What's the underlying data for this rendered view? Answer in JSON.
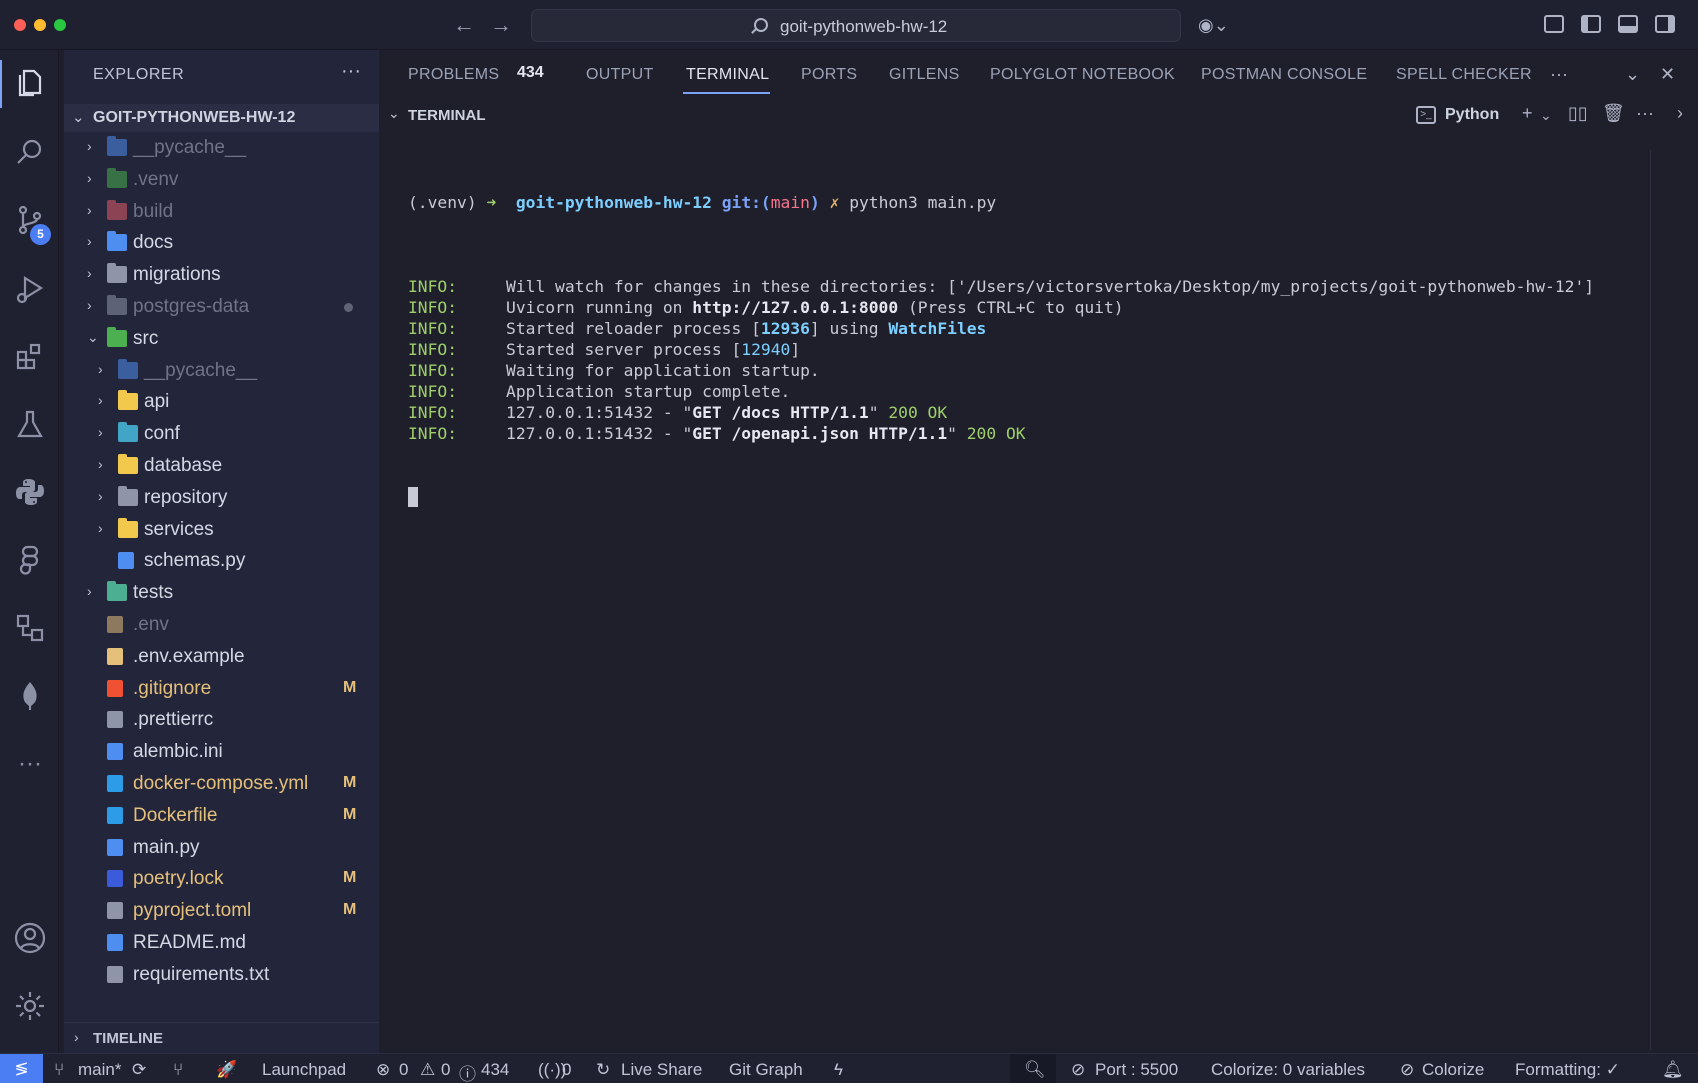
{
  "window": {
    "title": "goit-pythonweb-hw-12"
  },
  "activity": {
    "scm_badge": "5"
  },
  "sidebar": {
    "title": "EXPLORER",
    "more": "···",
    "root": "GOIT-PYTHONWEB-HW-12",
    "items": [
      {
        "label": "__pycache__",
        "kind": "folder",
        "indent": 0,
        "chevron": "›",
        "dim": true,
        "color": "#4d8ef0"
      },
      {
        "label": ".venv",
        "kind": "folder",
        "indent": 0,
        "chevron": "›",
        "dim": true,
        "color": "#4caf50"
      },
      {
        "label": "build",
        "kind": "folder",
        "indent": 0,
        "chevron": "›",
        "dim": true,
        "color": "#e35d6a"
      },
      {
        "label": "docs",
        "kind": "folder",
        "indent": 0,
        "chevron": "›",
        "color": "#4d8ef0"
      },
      {
        "label": "migrations",
        "kind": "folder",
        "indent": 0,
        "chevron": "›",
        "color": "#8f94a8"
      },
      {
        "label": "postgres-data",
        "kind": "folder",
        "indent": 0,
        "chevron": "›",
        "dim": true,
        "dot": true,
        "color": "#8f94a8"
      },
      {
        "label": "src",
        "kind": "folder",
        "indent": 0,
        "chevron": "⌄",
        "color": "#4caf50"
      },
      {
        "label": "__pycache__",
        "kind": "folder",
        "indent": 1,
        "chevron": "›",
        "dim": true,
        "color": "#4d8ef0"
      },
      {
        "label": "api",
        "kind": "folder",
        "indent": 1,
        "chevron": "›",
        "color": "#f2c94c"
      },
      {
        "label": "conf",
        "kind": "folder",
        "indent": 1,
        "chevron": "›",
        "color": "#42a5c5"
      },
      {
        "label": "database",
        "kind": "folder",
        "indent": 1,
        "chevron": "›",
        "color": "#f2c94c"
      },
      {
        "label": "repository",
        "kind": "folder",
        "indent": 1,
        "chevron": "›",
        "color": "#8f94a8"
      },
      {
        "label": "services",
        "kind": "folder",
        "indent": 1,
        "chevron": "›",
        "color": "#f2c94c"
      },
      {
        "label": "schemas.py",
        "kind": "file",
        "indent": 1,
        "color": "#4d8ef0"
      },
      {
        "label": "tests",
        "kind": "folder",
        "indent": 0,
        "chevron": "›",
        "color": "#4caf92"
      },
      {
        "label": ".env",
        "kind": "file",
        "indent": 0,
        "dim": true,
        "color": "#e5c07b"
      },
      {
        "label": ".env.example",
        "kind": "file",
        "indent": 0,
        "color": "#e5c07b"
      },
      {
        "label": ".gitignore",
        "kind": "file",
        "indent": 0,
        "modified": true,
        "status": "M",
        "color": "#f05133"
      },
      {
        "label": ".prettierrc",
        "kind": "file",
        "indent": 0,
        "color": "#8f94a8"
      },
      {
        "label": "alembic.ini",
        "kind": "file",
        "indent": 0,
        "color": "#4d8ef0"
      },
      {
        "label": "docker-compose.yml",
        "kind": "file",
        "indent": 0,
        "modified": true,
        "status": "M",
        "color": "#2d9ce8"
      },
      {
        "label": "Dockerfile",
        "kind": "file",
        "indent": 0,
        "modified": true,
        "status": "M",
        "color": "#2d9ce8"
      },
      {
        "label": "main.py",
        "kind": "file",
        "indent": 0,
        "color": "#4d8ef0"
      },
      {
        "label": "poetry.lock",
        "kind": "file",
        "indent": 0,
        "modified": true,
        "status": "M",
        "color": "#3b5bdb"
      },
      {
        "label": "pyproject.toml",
        "kind": "file",
        "indent": 0,
        "modified": true,
        "status": "M",
        "color": "#8f94a8"
      },
      {
        "label": "README.md",
        "kind": "file",
        "indent": 0,
        "color": "#4d8ef0"
      },
      {
        "label": "requirements.txt",
        "kind": "file",
        "indent": 0,
        "color": "#8f94a8"
      }
    ],
    "timeline": "TIMELINE"
  },
  "panel": {
    "tabs": [
      "PROBLEMS",
      "OUTPUT",
      "TERMINAL",
      "PORTS",
      "GITLENS",
      "POLYGLOT NOTEBOOK",
      "POSTMAN CONSOLE",
      "SPELL CHECKER"
    ],
    "problems_count": "434",
    "more": "···",
    "section": "TERMINAL",
    "profile": "Python"
  },
  "terminal": {
    "prompt_venv": "(.venv)",
    "prompt_arrow": "➜",
    "prompt_dir": "goit-pythonweb-hw-12",
    "prompt_git": "git:(",
    "prompt_branch": "main",
    "prompt_git_close": ")",
    "prompt_x": "✗",
    "command": "python3 main.py",
    "lines": [
      {
        "level": "INFO:",
        "parts": [
          {
            "t": "Will watch for changes in these directories: ['/Users/victorsvertoka/Desktop/my_projects/goit-pythonweb-hw-12']"
          }
        ]
      },
      {
        "level": "INFO:",
        "parts": [
          {
            "t": "Uvicorn running on "
          },
          {
            "t": "http://127.0.0.1:8000",
            "c": "white bold"
          },
          {
            "t": " (Press CTRL+C to quit)"
          }
        ]
      },
      {
        "level": "INFO:",
        "parts": [
          {
            "t": "Started reloader process ["
          },
          {
            "t": "12936",
            "c": "cyan bold"
          },
          {
            "t": "] using "
          },
          {
            "t": "WatchFiles",
            "c": "cyan bold"
          }
        ]
      },
      {
        "level": "INFO:",
        "parts": [
          {
            "t": "Started server process ["
          },
          {
            "t": "12940",
            "c": "cyan"
          },
          {
            "t": "]"
          }
        ]
      },
      {
        "level": "INFO:",
        "parts": [
          {
            "t": "Waiting for application startup."
          }
        ]
      },
      {
        "level": "INFO:",
        "parts": [
          {
            "t": "Application startup complete."
          }
        ]
      },
      {
        "level": "INFO:",
        "parts": [
          {
            "t": "127.0.0.1:51432 - \""
          },
          {
            "t": "GET /docs HTTP/1.1",
            "c": "white bold"
          },
          {
            "t": "\" "
          },
          {
            "t": "200 OK",
            "c": "green"
          }
        ]
      },
      {
        "level": "INFO:",
        "parts": [
          {
            "t": "127.0.0.1:51432 - \""
          },
          {
            "t": "GET /openapi.json HTTP/1.1",
            "c": "white bold"
          },
          {
            "t": "\" "
          },
          {
            "t": "200 OK",
            "c": "green"
          }
        ]
      }
    ]
  },
  "status": {
    "branch": "main*",
    "launchpad": "Launchpad",
    "errors": "0",
    "warnings": "0",
    "infos": "434",
    "ports": "0",
    "live_share": "Live Share",
    "git_graph": "Git Graph",
    "port": "Port : 5500",
    "colorize_vars": "Colorize: 0 variables",
    "colorize": "Colorize",
    "formatting": "Formatting: ✓"
  }
}
